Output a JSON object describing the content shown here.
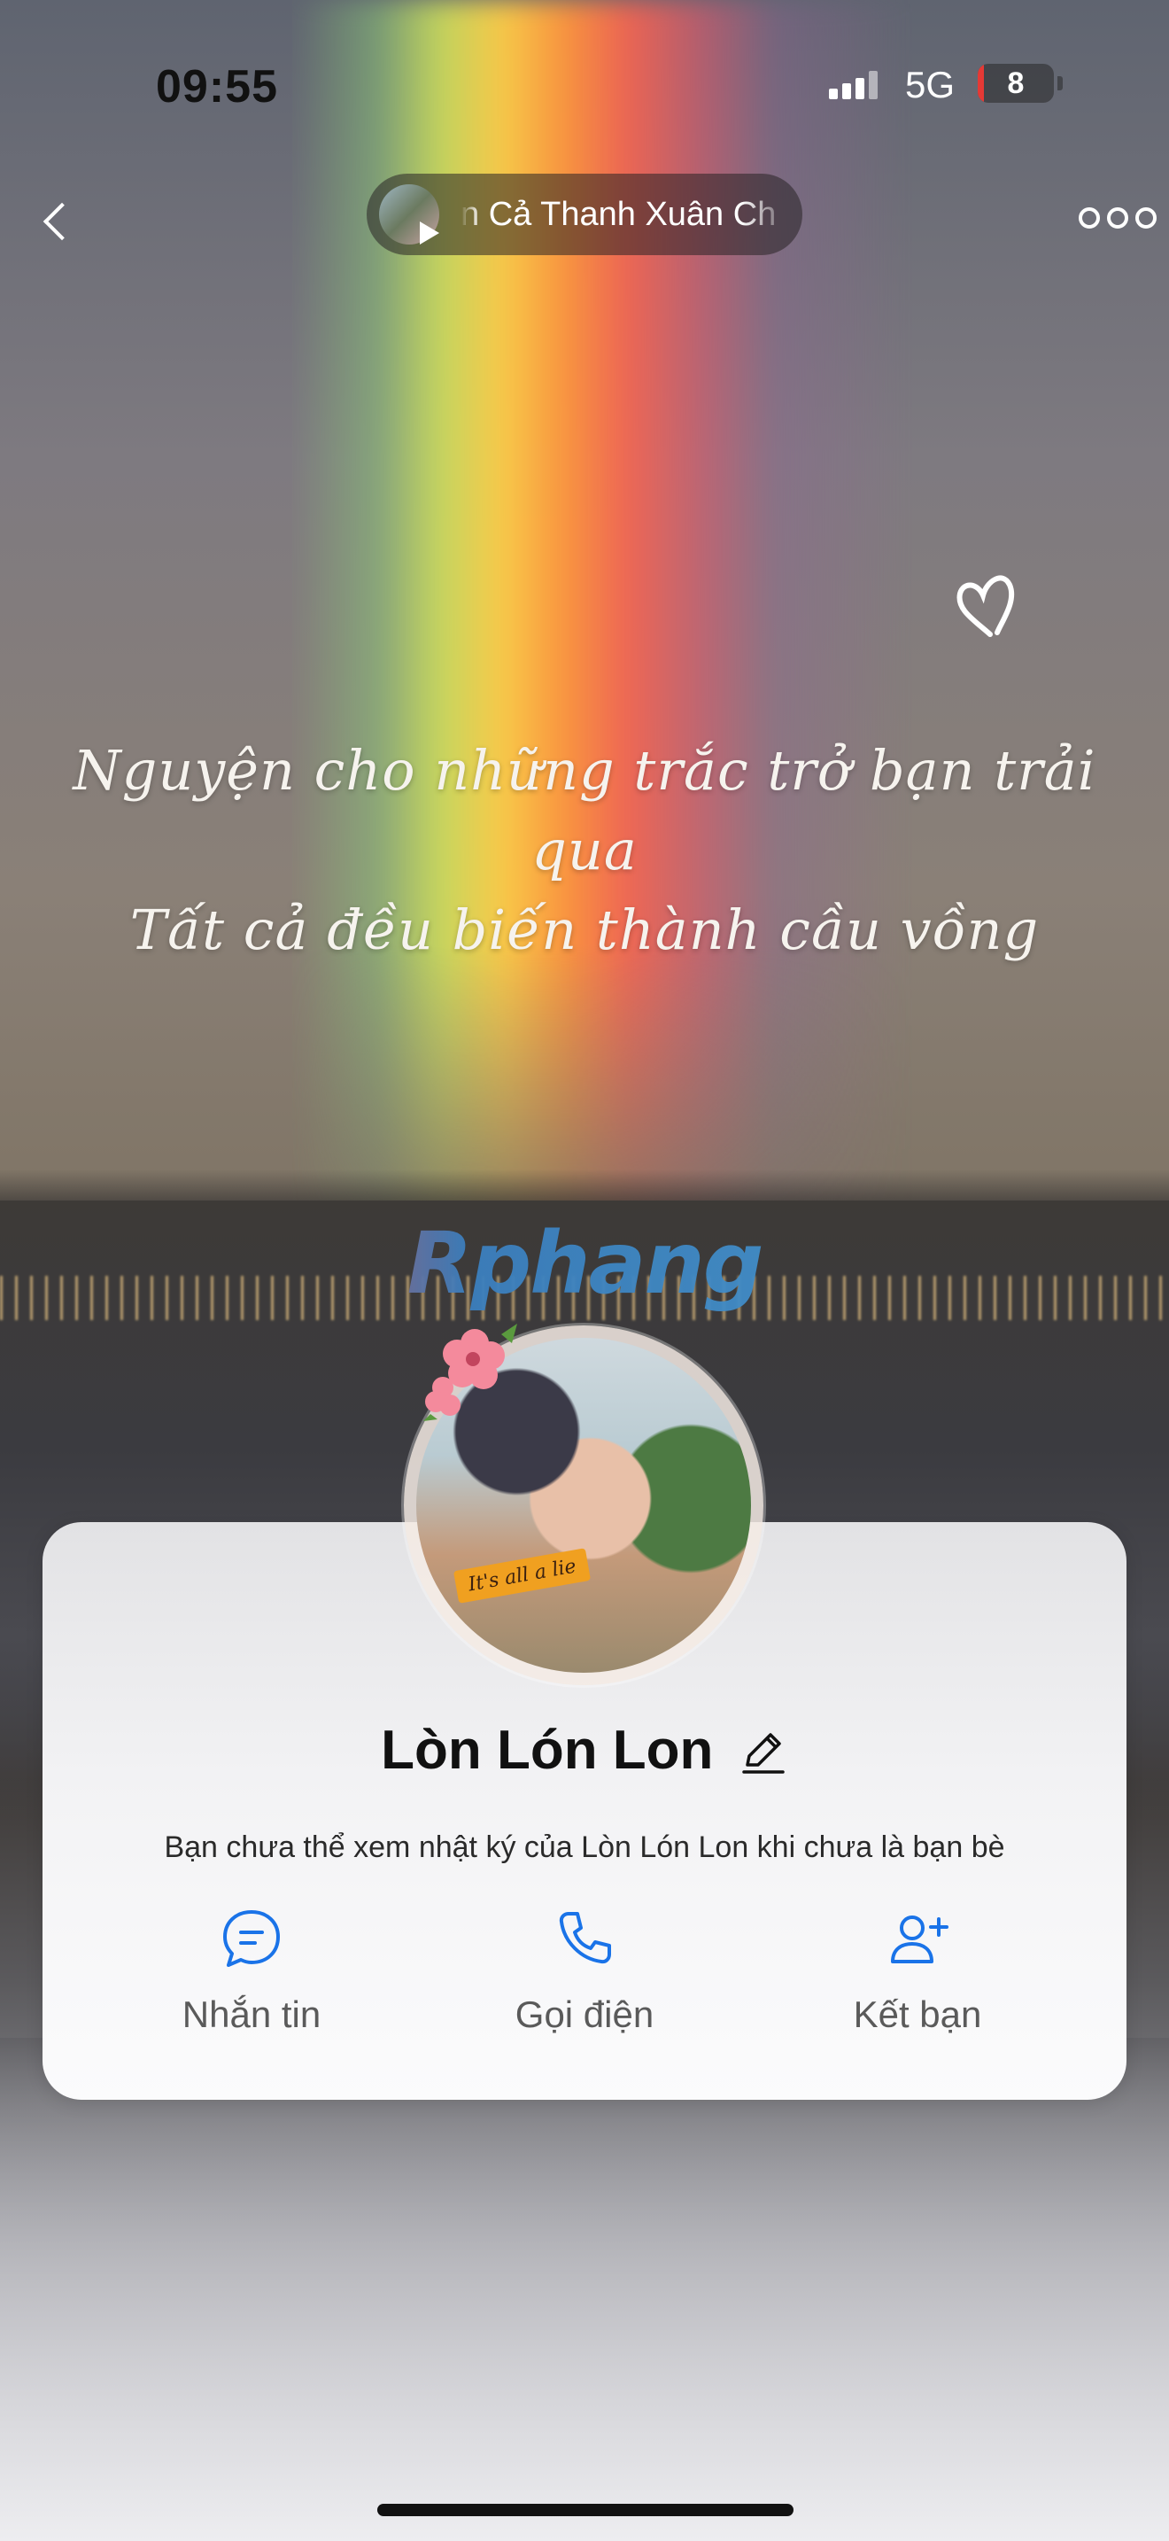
{
  "status_bar": {
    "time": "09:55",
    "network": "5G",
    "battery": "8",
    "battery_level": 0.08
  },
  "header": {
    "music_title": "n Cả Thanh Xuân Ch"
  },
  "cover": {
    "quote_line1": "Nguyện cho những trắc trở bạn trải qua",
    "quote_line2": "Tất cả đều biến thành cầu vồng",
    "watermark": "Rphang",
    "avatar_sticker": "It's all a lie"
  },
  "profile": {
    "name": "Lòn Lón Lon",
    "notice": "Bạn chưa thể xem nhật ký của Lòn Lón Lon khi chưa là bạn bè"
  },
  "actions": [
    {
      "label": "Nhắn tin",
      "icon": "message-icon"
    },
    {
      "label": "Gọi điện",
      "icon": "phone-icon"
    },
    {
      "label": "Kết bạn",
      "icon": "add-friend-icon"
    }
  ],
  "colors": {
    "accent": "#1a73e8",
    "battery_low": "#e53935"
  }
}
